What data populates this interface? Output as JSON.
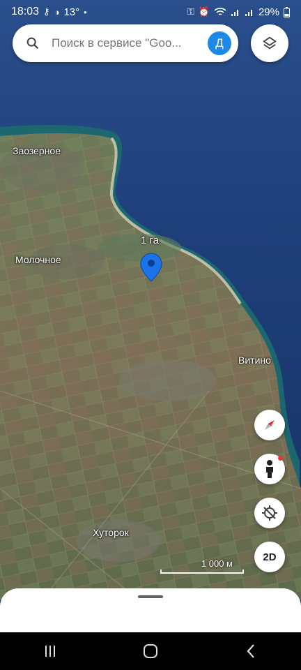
{
  "status_bar": {
    "time": "18:03",
    "temperature": "13°",
    "battery": "29%"
  },
  "search": {
    "placeholder": "Поиск в сервисе \"Goo...",
    "avatar_letter": "Д"
  },
  "map": {
    "places": {
      "zaozernoe": "Заозерное",
      "molochnoe": "Молочное",
      "vitino": "Витино",
      "khutorok": "Хуторок"
    },
    "pin_label": "1 га",
    "scale": "1 000 м"
  },
  "controls": {
    "mode_2d": "2D"
  },
  "colors": {
    "accent": "#1e88e5",
    "pin": "#1a73e8",
    "sea": "#1f3f7a"
  }
}
